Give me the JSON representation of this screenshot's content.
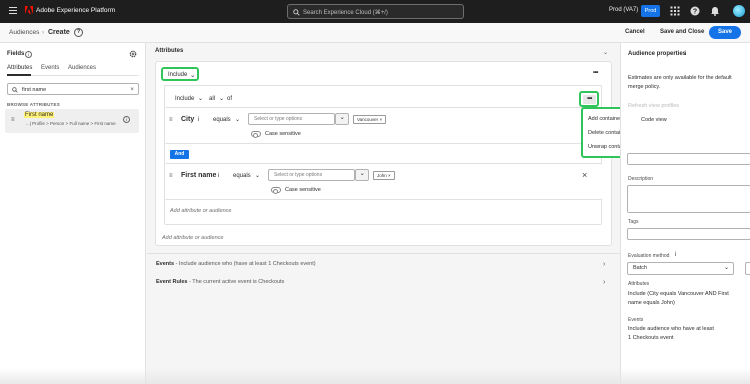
{
  "topbar": {
    "brand": "Adobe Experience Platform",
    "search_placeholder": "Search Experience Cloud (⌘+/)",
    "org": "Prod (VA7)",
    "sandbox": "Prod"
  },
  "header": {
    "breadcrumb_parent": "Audiences",
    "breadcrumb_current": "Create",
    "cancel": "Cancel",
    "save_close": "Save and Close",
    "save": "Save"
  },
  "left": {
    "title": "Fields",
    "tabs": [
      "Attributes",
      "Events",
      "Audiences"
    ],
    "search_value": "first name",
    "browse_label": "BROWSE ATTRIBUTES",
    "result_name": "First name",
    "result_path": "...| Profile > Person > Full name > First name"
  },
  "center": {
    "title": "Attributes",
    "include": "Include",
    "container_head": {
      "include": "Include",
      "all": "all",
      "of": "of"
    },
    "rules": [
      {
        "field": "City",
        "operator": "equals",
        "placeholder": "Select or type options",
        "tag": "Vancouver",
        "toggle": "Case sensitive"
      },
      {
        "field": "First name",
        "operator": "equals",
        "placeholder": "Select or type options",
        "tag": "John",
        "toggle": "Case sensitive"
      }
    ],
    "and": "And",
    "add_attr_inner": "Add attribute or audience",
    "add_attr_outer": "Add attribute or audience",
    "menu": [
      "Add container",
      "Delete container",
      "Unwrap container"
    ],
    "more": "•••",
    "events_bar": {
      "bold": "Events",
      "text": " - Include audience who (have at least 1 Checkouts event)"
    },
    "rules_bar": {
      "bold": "Event Rules",
      "text": " - The current active event is Checkouts"
    }
  },
  "right": {
    "title": "Audience properties",
    "estimate_note_1": "Estimates are only available for the default",
    "estimate_note_2": "merge policy.",
    "ghost_profiles": "Refresh view profiles",
    "code_view": "Code view",
    "description_label": "Description",
    "tags_label": "Tags",
    "eval_label": "Evaluation method",
    "eval_value": "Batch",
    "attributes_label": "Attributes",
    "attributes_text_1": "Include (City equals Vancouver AND First",
    "attributes_text_2": "name equals John)",
    "events_label": "Events",
    "events_text_1": "Include audience who have at least",
    "events_text_2": "1 Checkouts event"
  },
  "colors": {
    "accent": "#1473e6",
    "highlight": "#2fc55a",
    "topbar": "#1e1e1e"
  }
}
